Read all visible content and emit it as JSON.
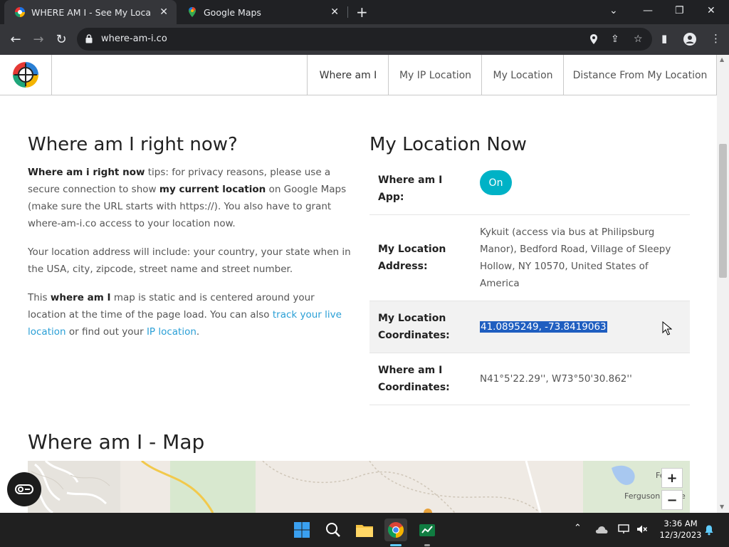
{
  "browser": {
    "tabs": [
      {
        "title": "WHERE AM I - See My Location I",
        "active": true
      },
      {
        "title": "Google Maps",
        "active": false
      }
    ],
    "url": "where-am-i.co"
  },
  "site": {
    "nav": [
      {
        "label": "Where am I",
        "active": true
      },
      {
        "label": "My IP Location",
        "active": false
      },
      {
        "label": "My Location",
        "active": false
      },
      {
        "label": "Distance From My Location",
        "active": false
      }
    ]
  },
  "left": {
    "heading": "Where am I right now?",
    "p1": {
      "b1": "Where am i right now",
      "t1": " tips: for privacy reasons, please use a secure connection to show ",
      "b2": "my current location",
      "t2": " on Google Maps (make sure the URL starts with https://). You also have to grant where-am-i.co access to your location now."
    },
    "p2": "Your location address will include: your country, your state when in the USA, city, zipcode, street name and street number.",
    "p3": {
      "t1": "This ",
      "b1": "where am I",
      "t2": " map is static and is centered around your location at the time of the page load. You can also ",
      "link1": "track your live location",
      "t3": " or find out your ",
      "link2": "IP location",
      "t4": "."
    }
  },
  "right": {
    "heading": "My Location Now",
    "rows": [
      {
        "label_l1": "Where am I",
        "label_l2": "App:",
        "value": "On"
      },
      {
        "label_l1": "My Location",
        "label_l2": "Address:",
        "value_lines": [
          "Kykuit (access via bus at Philipsburg",
          "Manor), Bedford Road, Village of Sleepy",
          "Hollow, NY 10570, United States of",
          "America"
        ]
      },
      {
        "label_l1": "My Location",
        "label_l2": "Coordinates:",
        "value": "41.0895249, -73.8419063"
      },
      {
        "label_l1": "Where am I",
        "label_l2": "Coordinates:",
        "value": "N41°5'22.29'', W73°50'30.862''"
      }
    ]
  },
  "map": {
    "heading": "Where am I - Map",
    "labels": [
      "Fe",
      "Ferguson",
      "e"
    ],
    "zoom_in": "+",
    "zoom_out": "−"
  },
  "taskbar": {
    "time": "3:36 AM",
    "date": "12/3/2023"
  }
}
